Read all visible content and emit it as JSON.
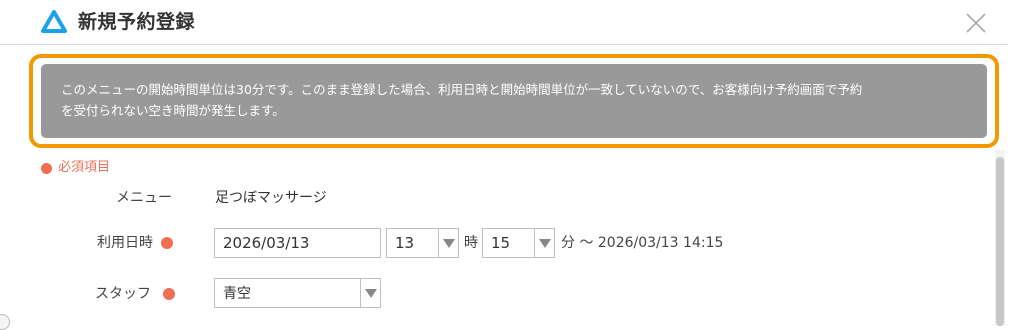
{
  "header": {
    "title": "新規予約登録",
    "logo_icon": "triangle-logo-icon",
    "close_icon": "close-icon",
    "brand_color": "#1aa3e8"
  },
  "warning": {
    "line1": "このメニューの開始時間単位は30分です。このまま登録した場合、利用日時と開始時間単位が一致していないので、お客様向け予約画面で予約",
    "line2": "を受付られない空き時間が発生します。",
    "highlight_color": "#f39800",
    "background_color": "#999999"
  },
  "form": {
    "required_note": "必須項目",
    "required_color": "#f06e52",
    "menu": {
      "label": "メニュー",
      "value": "足つぼマッサージ"
    },
    "datetime": {
      "label": "利用日時",
      "date_value": "2026/03/13",
      "hour_value": "13",
      "hour_unit": "時",
      "minute_value": "15",
      "range_text": "分 〜 2026/03/13 14:15"
    },
    "staff": {
      "label": "スタッフ",
      "value": "青空"
    }
  }
}
